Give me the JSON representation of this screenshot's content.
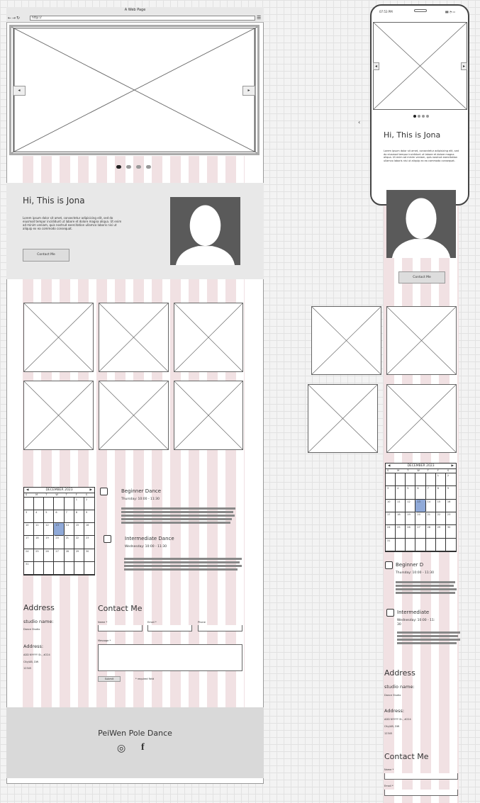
{
  "browser": {
    "title": "A Web Page",
    "nav_icons": "←→↻",
    "url": "http://",
    "menu_glyph": "☰"
  },
  "carousel": {
    "prev": "◂",
    "next": "▸",
    "dots": 4,
    "active_dot": 1
  },
  "hero": {
    "title": "Hi, This is Jona",
    "body": "Lorem ipsum dolor sit amet, consectetur adipisicing elit, sed do eiusmod tempor incididunt ut labore et dolore magna aliqua. Ut enim ad minim veniam, quis nostrud exercitation ullamco laboris nisi ut aliquip ex ea commodo consequat.",
    "contact_button": "Contact Me"
  },
  "calendar": {
    "month": "DECEMBER 2023",
    "prev": "◀",
    "next": "▶",
    "day_headers": [
      "S",
      "M",
      "T",
      "W",
      "T",
      "F",
      "S"
    ],
    "cells": [
      "",
      "",
      "",
      "",
      "",
      "1",
      "2",
      "3",
      "4",
      "5",
      "6",
      "7",
      "8",
      "9",
      "10",
      "11",
      "12",
      "13",
      "14",
      "15",
      "16",
      "17",
      "18",
      "19",
      "20",
      "21",
      "22",
      "23",
      "24",
      "25",
      "26",
      "27",
      "28",
      "29",
      "30",
      "31",
      "",
      "",
      "",
      "",
      "",
      ""
    ],
    "today": "13"
  },
  "classes": [
    {
      "title": "Beginner Dance",
      "time": "Thursday: 10:00 - 11:30"
    },
    {
      "title": "Intermediate Dance",
      "time": "Wednesday: 10:00 - 11:30"
    }
  ],
  "address": {
    "title": "Address",
    "studio_label": "studio name:",
    "studio_value": "Dance Studio",
    "address_label": "Address:",
    "line1": "ADD NYYYY St., #224",
    "line2": "City/AB, DW",
    "line3": "12345"
  },
  "contact": {
    "title": "Contact Me",
    "name_label": "Name *",
    "email_label": "Email *",
    "phone_label": "Phone",
    "message_label": "Message *",
    "submit": "Submit",
    "required_note": "* required field"
  },
  "footer": {
    "brand": "PeiWen Pole Dance",
    "instagram_icon": "instagram-icon",
    "facebook_icon": "facebook-icon",
    "instagram_glyph": "◎",
    "facebook_glyph": "f"
  },
  "mobile": {
    "status_time": "07:53 PM",
    "status_icons": "▮▮ ◔ ▭",
    "back": "‹",
    "hero_title": "Hi, This is Jona",
    "hero_body": "Lorem ipsum dolor sit amet, consectetur adipisicing elit, sed do eiusmod tempor incididunt ut labore et dolore magna aliqua. Ut enim ad minim veniam, quis nostrud exercitation ullamco laboris nisi ut aliquip ex ea commodo consequat.",
    "contact_button": "Contact Me",
    "class1_title": "Beginner D",
    "class1_time": "Thursday: 10:00 - 11:30",
    "class2_title": "Intermediate",
    "class2_time": "Wednesday: 10:00 - 11:",
    "class2_time2": "30",
    "address_title": "Address",
    "studio_label": "studio name:",
    "studio_value": "Dance Studio",
    "address_label": "Address:",
    "line1": "ADD NYYYY St., #224",
    "line2": "City/AB, DW",
    "line3": "12345",
    "contact_title": "Contact Me",
    "name_label": "Name *",
    "email_label": "Email *"
  }
}
